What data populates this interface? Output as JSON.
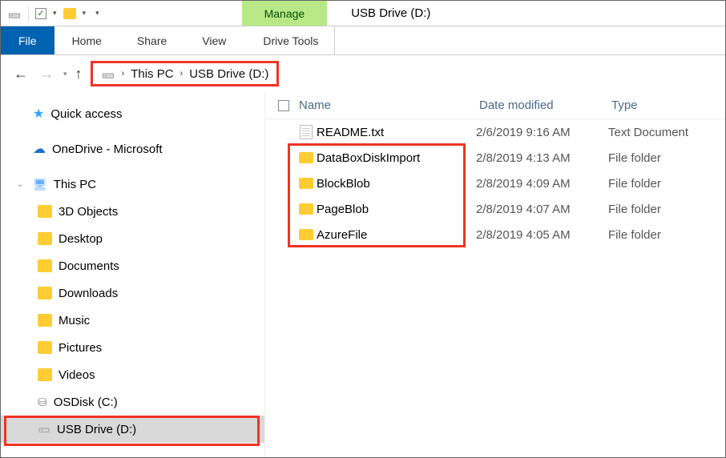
{
  "title_tab_context": "Manage",
  "title_window": "USB Drive (D:)",
  "ribbon": {
    "file": "File",
    "home": "Home",
    "share": "Share",
    "view": "View",
    "drive_tools": "Drive Tools"
  },
  "breadcrumb": {
    "root": "This PC",
    "leaf": "USB Drive (D:)"
  },
  "navpane": {
    "quick_access": "Quick access",
    "onedrive": "OneDrive - Microsoft",
    "this_pc": "This PC",
    "items": [
      "3D Objects",
      "Desktop",
      "Documents",
      "Downloads",
      "Music",
      "Pictures",
      "Videos",
      "OSDisk (C:)",
      "USB Drive (D:)"
    ]
  },
  "columns": {
    "name": "Name",
    "date": "Date modified",
    "type": "Type"
  },
  "rows": [
    {
      "name": "README.txt",
      "date": "2/6/2019 9:16 AM",
      "type": "Text Document",
      "kind": "txt"
    },
    {
      "name": "DataBoxDiskImport",
      "date": "2/8/2019 4:13 AM",
      "type": "File folder",
      "kind": "folder"
    },
    {
      "name": "BlockBlob",
      "date": "2/8/2019 4:09 AM",
      "type": "File folder",
      "kind": "folder"
    },
    {
      "name": "PageBlob",
      "date": "2/8/2019 4:07 AM",
      "type": "File folder",
      "kind": "folder"
    },
    {
      "name": "AzureFile",
      "date": "2/8/2019 4:05 AM",
      "type": "File folder",
      "kind": "folder"
    }
  ]
}
